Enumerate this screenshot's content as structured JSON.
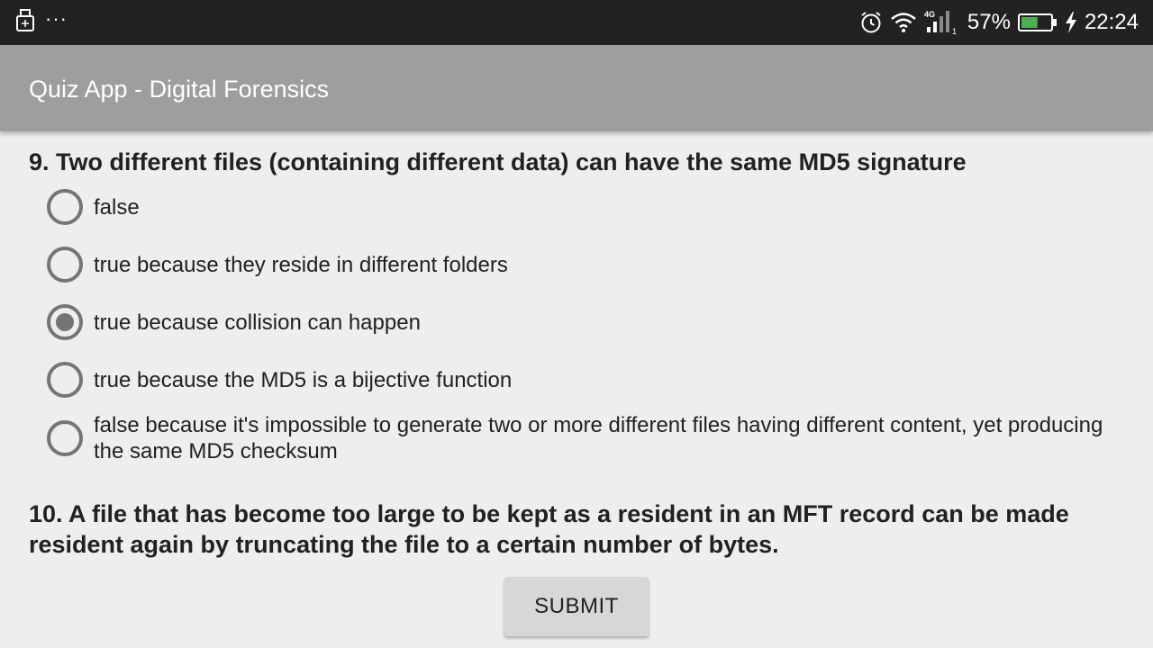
{
  "status_bar": {
    "left_icons": [
      "usb-icon",
      "more-notifications-icon"
    ],
    "more_indicator": "···",
    "network_type": "4G",
    "battery_percent": "57%",
    "battery_level": 0.57,
    "time": "22:24"
  },
  "app_bar": {
    "title": "Quiz App - Digital Forensics"
  },
  "quiz": {
    "question9": {
      "text": "9. Two different files (containing different data) can have the same MD5 signature",
      "options": [
        {
          "label": "false",
          "checked": false
        },
        {
          "label": "true because they reside in different folders",
          "checked": false
        },
        {
          "label": "true because collision can happen",
          "checked": true
        },
        {
          "label": "true because the MD5 is a bijective function",
          "checked": false
        },
        {
          "label": "false because it's impossible to generate two or more different files having different content, yet producing the same MD5 checksum",
          "checked": false
        }
      ]
    },
    "question10": {
      "text": "10. A file that has become too large to be kept as a resident in an MFT record can be made resident again by truncating the file to a certain number of bytes."
    },
    "submit_label": "SUBMIT"
  },
  "colors": {
    "status_bar": "#222222",
    "app_bar": "#9e9e9e",
    "background": "#eeeeee",
    "radio": "#757575",
    "battery_fill": "#4caf50",
    "button": "#d6d7d7"
  }
}
